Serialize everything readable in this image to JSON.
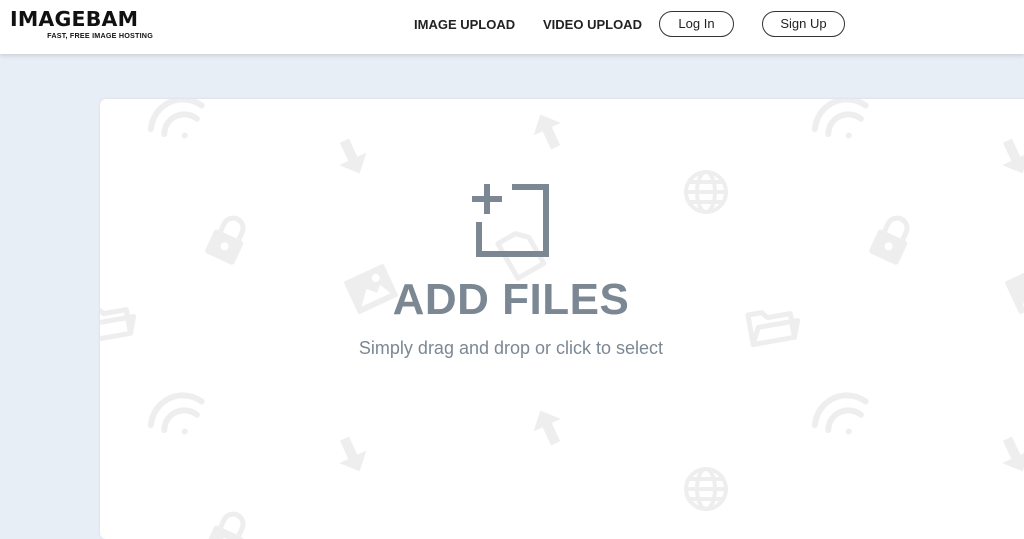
{
  "header": {
    "logo": {
      "name": "IMAGEBAM",
      "tagline": "FAST, FREE IMAGE HOSTING"
    },
    "nav": {
      "image_upload": "IMAGE UPLOAD",
      "video_upload": "VIDEO UPLOAD",
      "login": "Log In",
      "signup": "Sign Up"
    }
  },
  "dropzone": {
    "title": "ADD FILES",
    "subtitle": "Simply drag and drop or click to select",
    "icon": "add-file-icon",
    "background_icons": [
      "wifi-icon",
      "arrow-down-icon",
      "arrow-up-icon",
      "globe-icon",
      "lock-icon",
      "file-icon",
      "image-icon",
      "folder-icon"
    ]
  },
  "colors": {
    "page_background": "#e8eef5",
    "dropzone_text": "#7b8894",
    "background_icon": "#eeeeee"
  }
}
